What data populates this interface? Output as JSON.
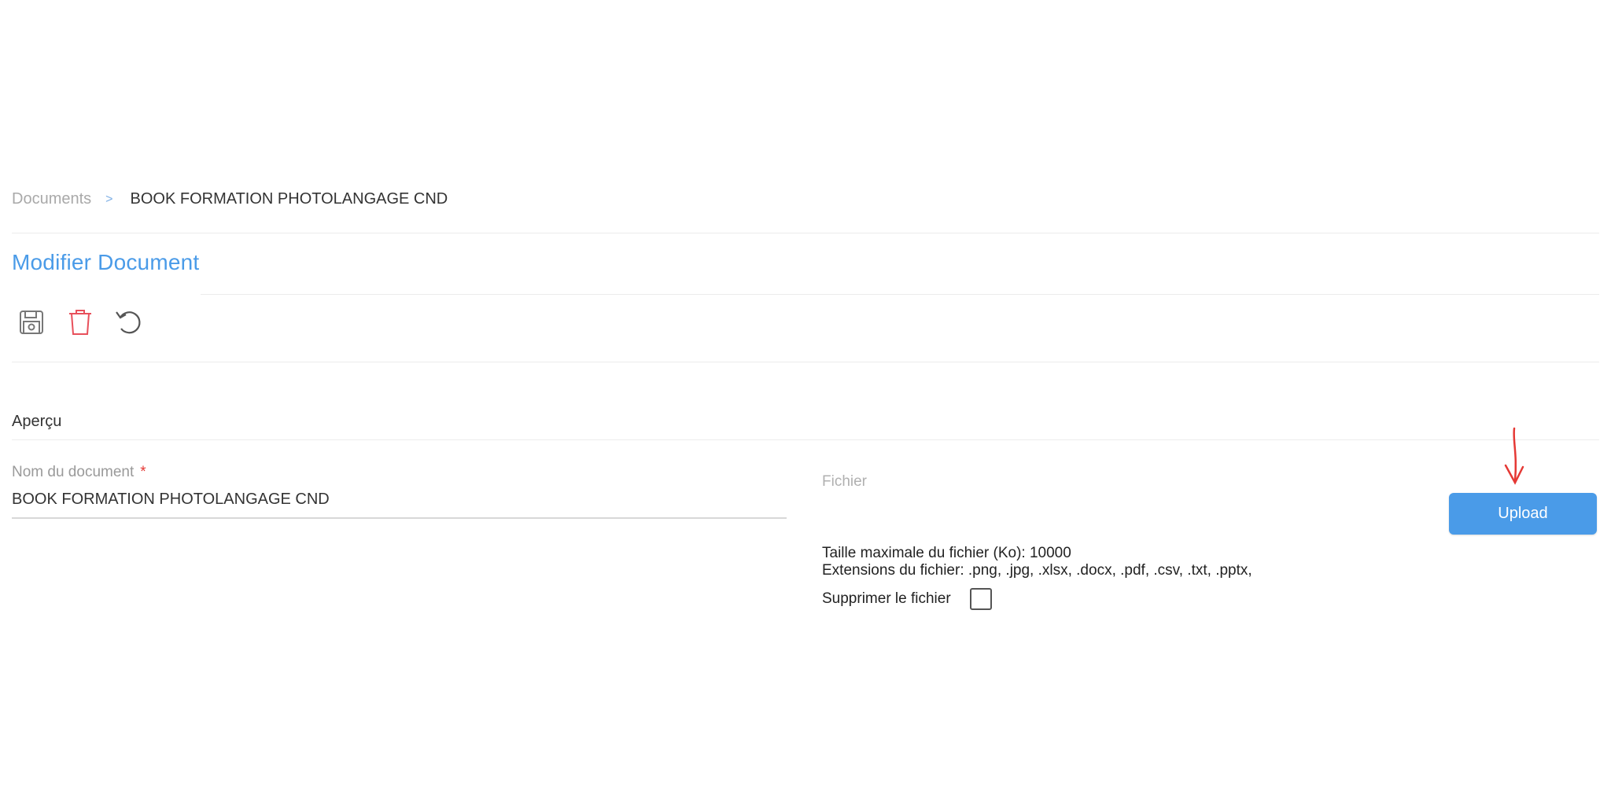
{
  "breadcrumb": {
    "root": "Documents",
    "separator": ">",
    "current": "BOOK FORMATION PHOTOLANGAGE CND"
  },
  "page": {
    "title": "Modifier Document"
  },
  "toolbar": {
    "icons": [
      "save-icon",
      "trash-icon",
      "undo-icon"
    ],
    "save_color": "#777777",
    "delete_color": "#e8505b",
    "undo_color": "#555555"
  },
  "section": {
    "title": "Aperçu"
  },
  "form": {
    "name_label": "Nom du document",
    "required_marker": "*",
    "name_value": "BOOK FORMATION PHOTOLANGAGE CND",
    "file_label": "Fichier",
    "upload_label": "Upload",
    "max_size": "Taille maximale du fichier (Ko): 10000",
    "extensions": "Extensions du fichier: .png, .jpg, .xlsx, .docx, .pdf, .csv, .txt, .pptx,",
    "delete_file_label": "Supprimer le fichier",
    "delete_file_checked": false
  },
  "colors": {
    "accent": "#4a9be8",
    "annotation": "#e53935"
  }
}
